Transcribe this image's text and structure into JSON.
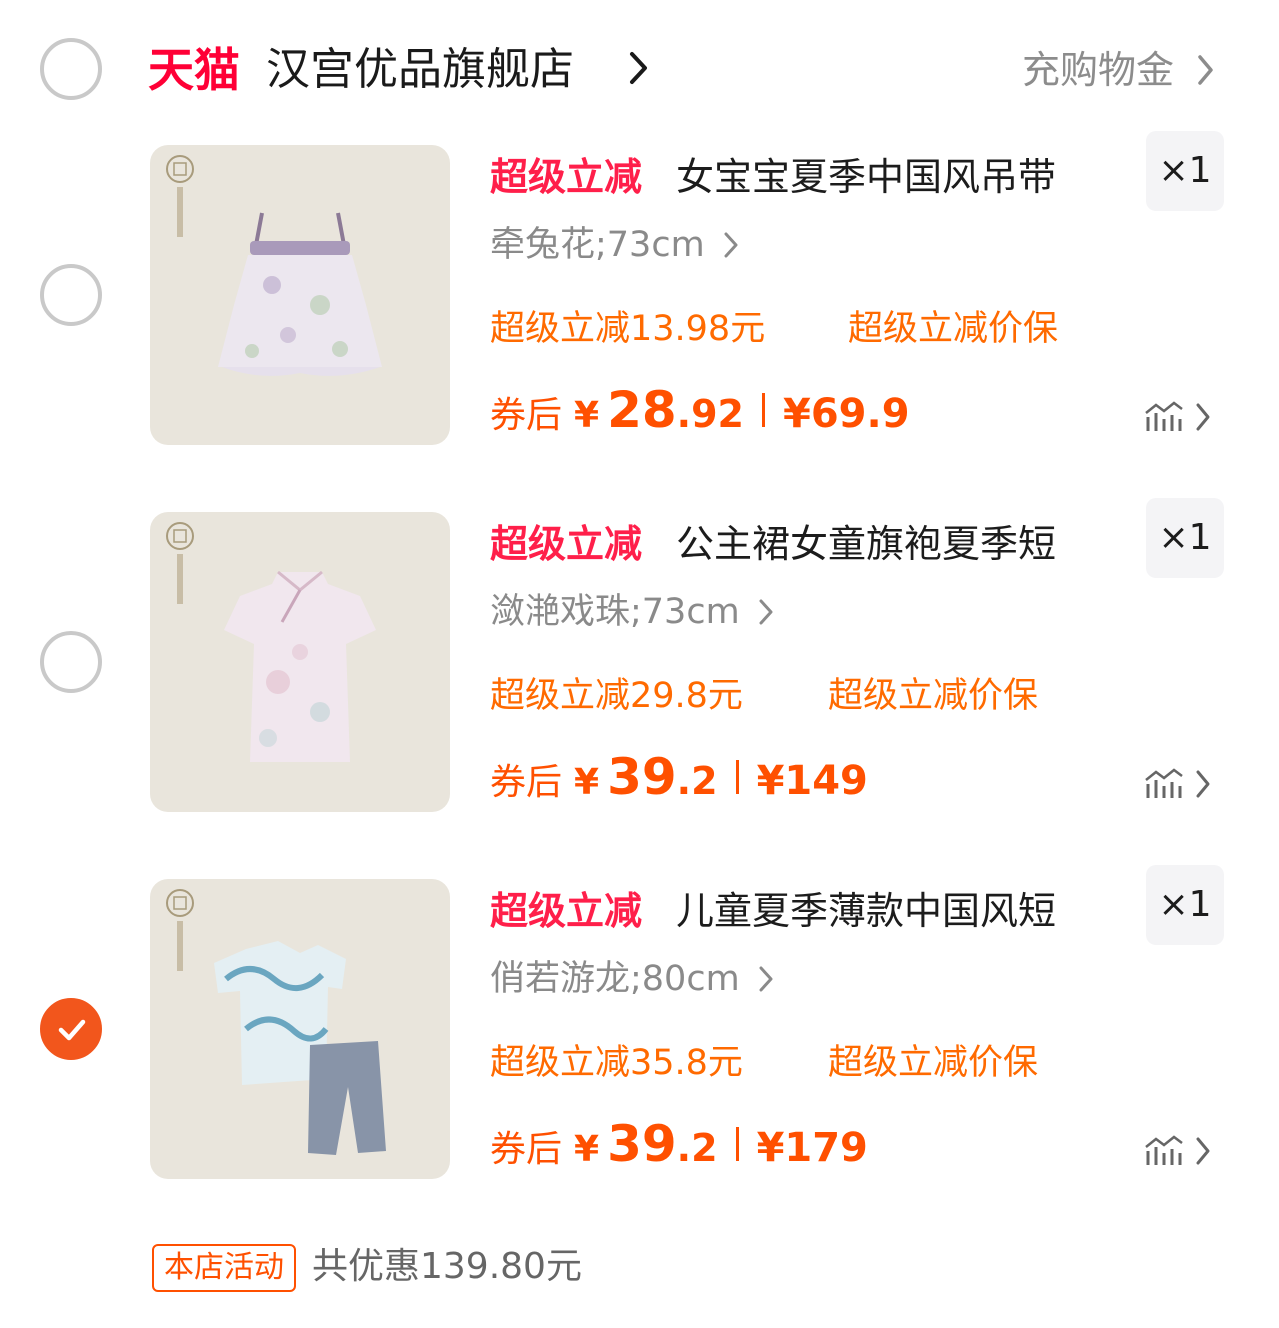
{
  "shop": {
    "brand": "天猫",
    "name": "汉宫优品旗舰店",
    "bonus_link": "充购物金"
  },
  "products": [
    {
      "tag": "超级立减",
      "title": "女宝宝夏季中国风吊带",
      "qty": "×1",
      "sku": "牵兔花;73cm",
      "promo": "超级立减13.98元",
      "promo_badge": "超级立减价保",
      "price_label": "券后",
      "price_yen": "¥",
      "price_int": "28",
      "price_dec": ".92",
      "orig_price": "¥69.9",
      "checked": false
    },
    {
      "tag": "超级立减",
      "title": "公主裙女童旗袍夏季短",
      "qty": "×1",
      "sku": "潋滟戏珠;73cm",
      "promo": "超级立减29.8元",
      "promo_badge": "超级立减价保",
      "price_label": "券后",
      "price_yen": "¥",
      "price_int": "39",
      "price_dec": ".2",
      "orig_price": "¥149",
      "checked": false
    },
    {
      "tag": "超级立减",
      "title": "儿童夏季薄款中国风短",
      "qty": "×1",
      "sku": "俏若游龙;80cm",
      "promo": "超级立减35.8元",
      "promo_badge": "超级立减价保",
      "price_label": "券后",
      "price_yen": "¥",
      "price_int": "39",
      "price_dec": ".2",
      "orig_price": "¥179",
      "checked": true
    }
  ],
  "footer": {
    "store_tag": "本店活动",
    "total": "共优惠139.80元"
  },
  "logo_text": "汉宫优品",
  "colors": {
    "brand": "#ff0036",
    "accent": "#ff5000",
    "title_tag": "#ff1f4a",
    "radio_checked": "#f2561c"
  },
  "icons": [
    "chevron-right-icon",
    "check-icon",
    "price-trend-icon"
  ]
}
